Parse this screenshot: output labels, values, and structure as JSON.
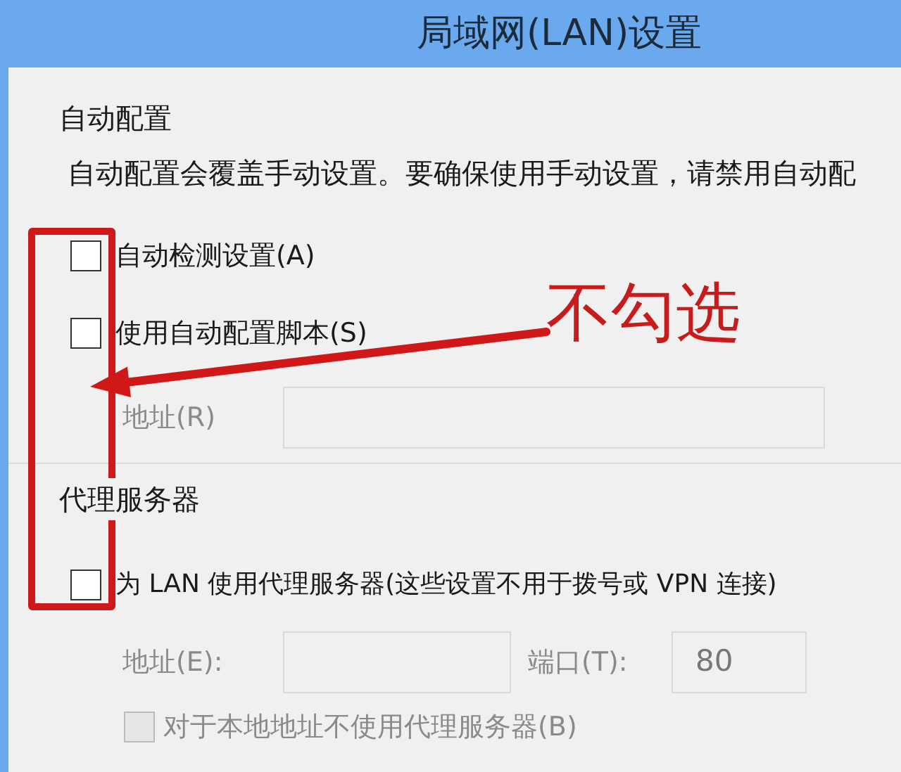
{
  "window": {
    "title": "局域网(LAN)设置"
  },
  "auto_config": {
    "heading": "自动配置",
    "description": "自动配置会覆盖手动设置。要确保使用手动设置，请禁用自动配",
    "options": [
      {
        "label": "自动检测设置(A)",
        "checked": false,
        "disabled": false
      },
      {
        "label": "使用自动配置脚本(S)",
        "checked": false,
        "disabled": false
      }
    ],
    "address": {
      "label": "地址(R)",
      "disabled": true
    }
  },
  "proxy": {
    "heading": "代理服务器",
    "option": {
      "label": "为 LAN 使用代理服务器(这些设置不用于拨号或 VPN 连接)",
      "checked": false,
      "disabled": false
    },
    "address": {
      "label": "地址(E):",
      "disabled": true
    },
    "port": {
      "label": "端口(T):",
      "value": "80",
      "disabled": true
    },
    "bypass": {
      "label": "对于本地地址不使用代理服务器(B)",
      "checked": false,
      "disabled": true
    }
  },
  "annotation": {
    "note": "不勾选"
  }
}
